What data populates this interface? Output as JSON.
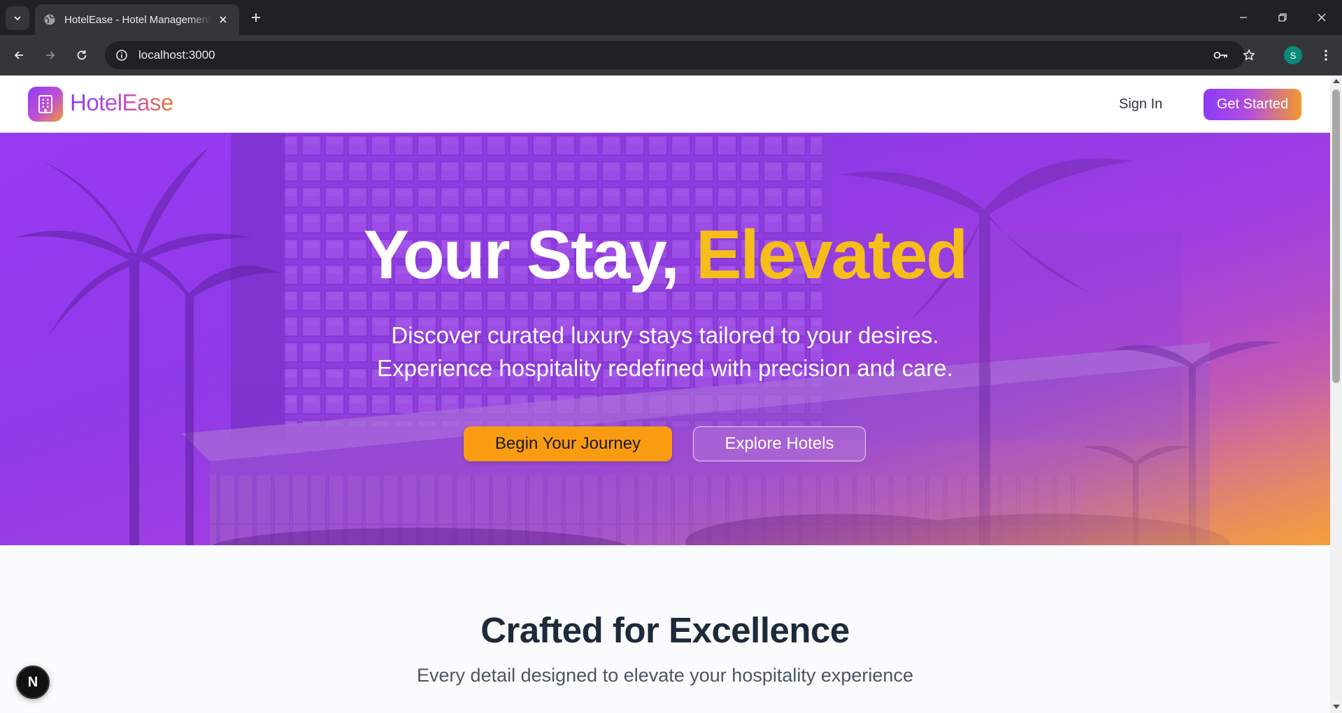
{
  "browser": {
    "tab_title": "HotelEase - Hotel Management",
    "url": "localhost:3000",
    "profile_initial": "S",
    "icons": {
      "tab_search": "chevron-down-icon",
      "favicon": "globe-icon",
      "close": "close-icon",
      "new_tab": "plus-icon",
      "back": "arrow-left-icon",
      "forward": "arrow-right-icon",
      "reload": "reload-icon",
      "site_info": "info-icon",
      "password": "key-icon",
      "bookmark": "star-icon",
      "menu": "kebab-menu-icon"
    }
  },
  "header": {
    "brand": "HotelEase",
    "logo_icon": "building-icon",
    "sign_in": "Sign In",
    "get_started": "Get Started"
  },
  "hero": {
    "title_main": "Your Stay,",
    "title_accent": "Elevated",
    "subtitle_line1": "Discover curated luxury stays tailored to your desires.",
    "subtitle_line2": "Experience hospitality redefined with precision and care.",
    "primary_cta": "Begin Your Journey",
    "secondary_cta": "Explore Hotels"
  },
  "features": {
    "title": "Crafted for Excellence",
    "subtitle": "Every detail designed to elevate your hospitality experience"
  },
  "dev_indicator": {
    "label": "N"
  },
  "colors": {
    "brand_purple": "#8b3cf6",
    "brand_orange": "#f39a2e",
    "accent_yellow": "#f5be1a",
    "cta_orange": "#fa9c12",
    "heading_dark": "#1e2a3a"
  }
}
